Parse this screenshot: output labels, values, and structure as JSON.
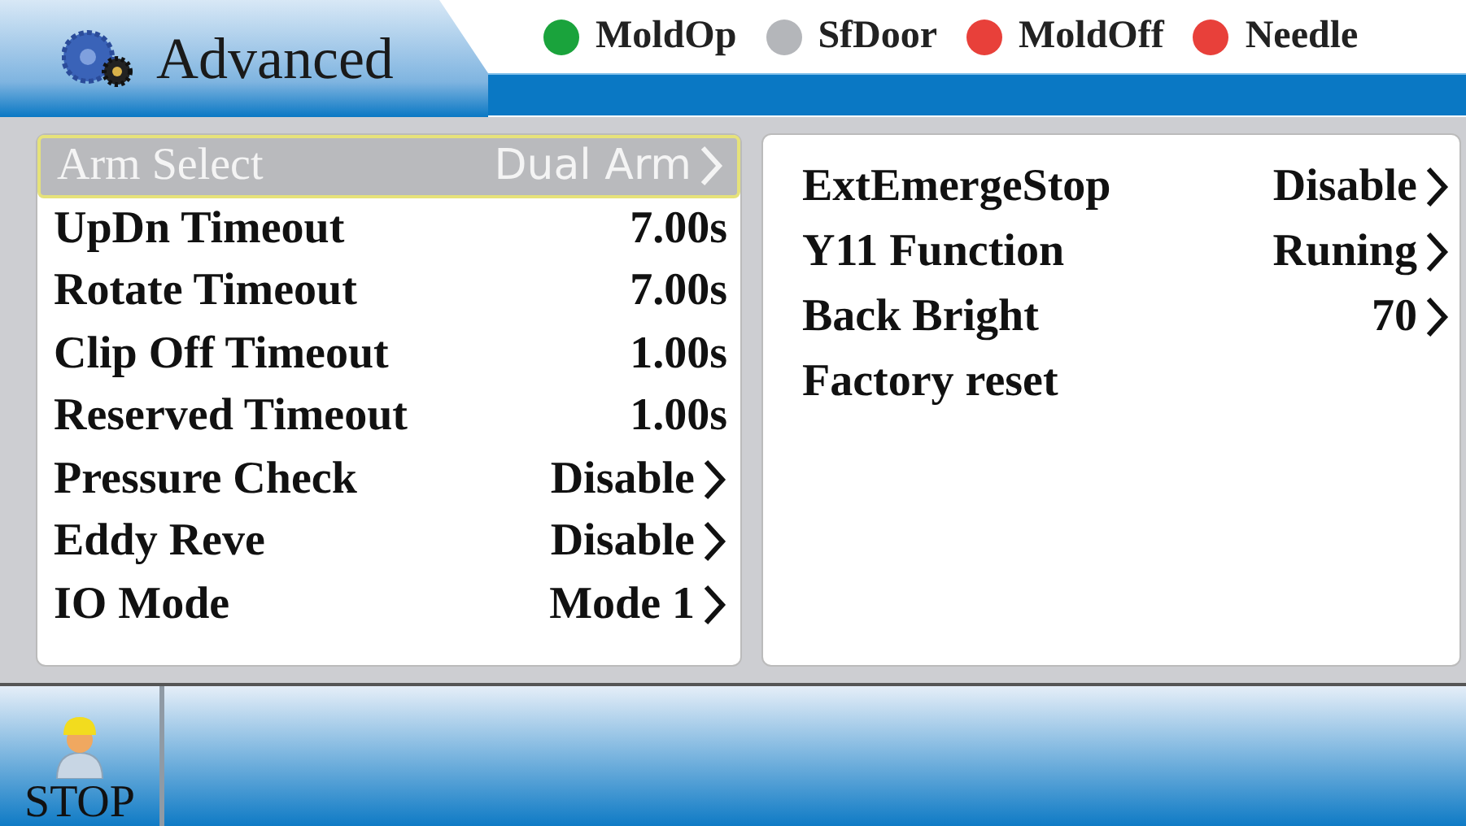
{
  "header": {
    "title": "Advanced"
  },
  "indicators": [
    {
      "label": "MoldOp",
      "color": "#1aa33c"
    },
    {
      "label": "SfDoor",
      "color": "#b4b6ba"
    },
    {
      "label": "MoldOff",
      "color": "#e8403a"
    },
    {
      "label": "Needle",
      "color": "#e8403a"
    }
  ],
  "left_settings": [
    {
      "label": "Arm Select",
      "value": "Dual Arm",
      "submenu": true,
      "selected": true
    },
    {
      "label": "UpDn Timeout",
      "value": "7.00s",
      "submenu": false,
      "selected": false
    },
    {
      "label": "Rotate Timeout",
      "value": "7.00s",
      "submenu": false,
      "selected": false
    },
    {
      "label": "Clip Off Timeout",
      "value": "1.00s",
      "submenu": false,
      "selected": false
    },
    {
      "label": "Reserved Timeout",
      "value": "1.00s",
      "submenu": false,
      "selected": false
    },
    {
      "label": "Pressure Check",
      "value": "Disable",
      "submenu": true,
      "selected": false
    },
    {
      "label": "Eddy Reve",
      "value": "Disable",
      "submenu": true,
      "selected": false
    },
    {
      "label": "IO Mode",
      "value": "Mode 1",
      "submenu": true,
      "selected": false
    }
  ],
  "right_settings": [
    {
      "label": "ExtEmergeStop",
      "value": "Disable",
      "submenu": true,
      "selected": false
    },
    {
      "label": "Y11 Function",
      "value": "Runing",
      "submenu": true,
      "selected": false
    },
    {
      "label": "Back Bright",
      "value": "70",
      "submenu": true,
      "selected": false
    },
    {
      "label": "Factory reset",
      "submenu": false,
      "selected": false
    }
  ],
  "footer": {
    "stop_label": "STOP"
  }
}
